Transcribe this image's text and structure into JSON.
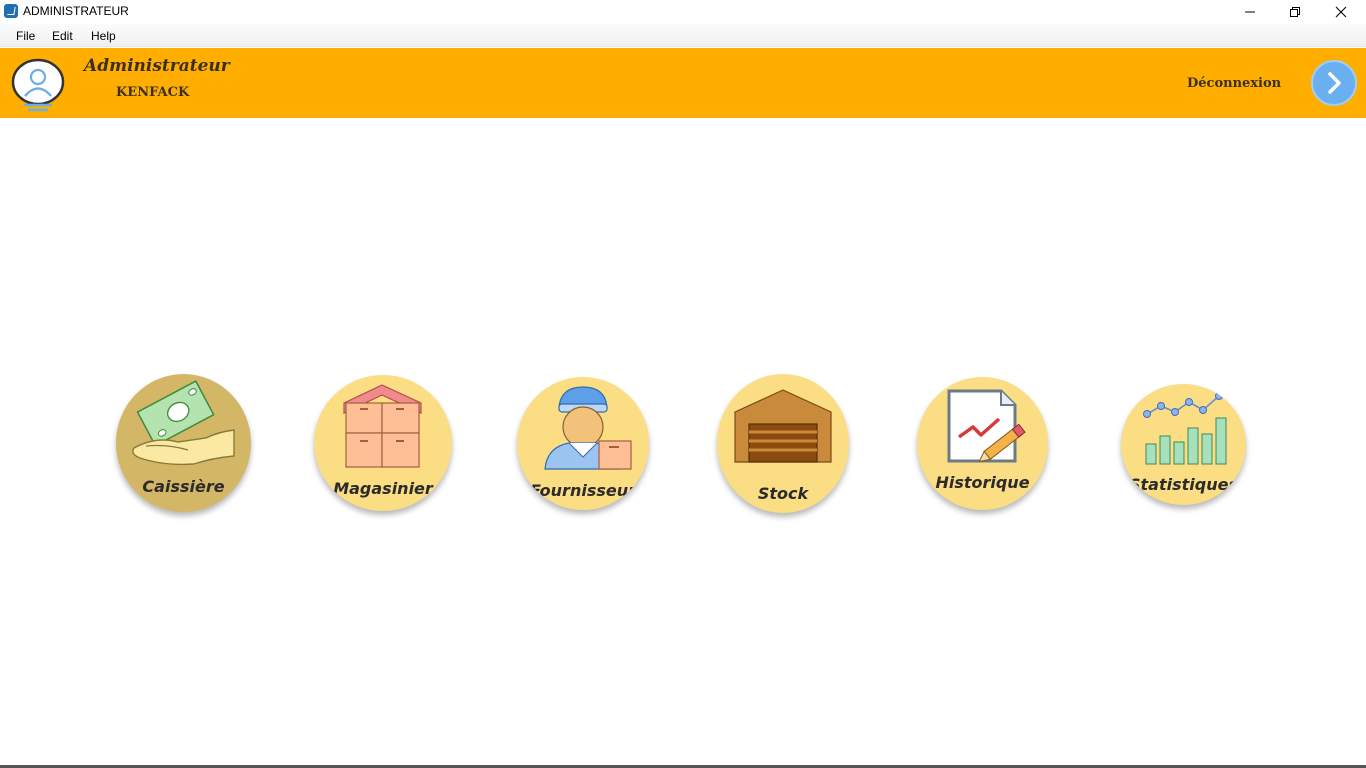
{
  "window": {
    "title": "ADMINISTRATEUR",
    "controls": [
      "minimize",
      "maximize",
      "close"
    ]
  },
  "menu": {
    "items": [
      {
        "label": "File"
      },
      {
        "label": "Edit"
      },
      {
        "label": "Help"
      }
    ]
  },
  "header": {
    "role": "Administrateur",
    "username": "KENFACK",
    "logout_label": "Déconnexion",
    "background_color": "#ffae00",
    "avatar_icon": "user-avatar-icon",
    "logout_icon": "chevron-right-icon"
  },
  "modules": [
    {
      "label": "Caissière",
      "icon": "cash-hand-icon",
      "active": true
    },
    {
      "label": "Magasinier",
      "icon": "warehouse-boxes-icon",
      "active": false
    },
    {
      "label": "Fournisseur",
      "icon": "delivery-man-icon",
      "active": false
    },
    {
      "label": "Stock",
      "icon": "garage-storage-icon",
      "active": false
    },
    {
      "label": "Historique",
      "icon": "document-chart-pencil-icon",
      "active": false
    },
    {
      "label": "Statistiques",
      "icon": "bar-line-chart-icon",
      "active": false
    }
  ],
  "colors": {
    "tile": "#fbdd84",
    "tile_active": "#d4b766",
    "logout_button": "#6ab0f0"
  }
}
